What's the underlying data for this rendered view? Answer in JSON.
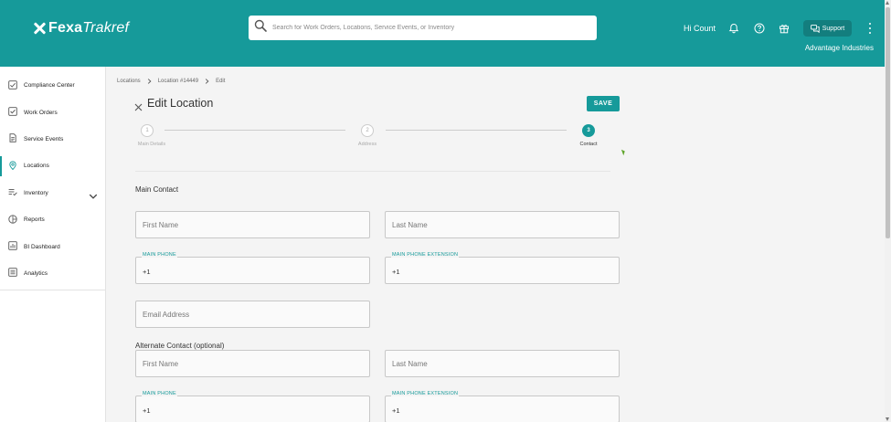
{
  "header": {
    "logo_bold": "Fexa",
    "logo_light": "Trakref",
    "search_placeholder": "Search for Work Orders, Locations, Service Events, or Inventory",
    "greeting": "Hi Count",
    "support_label": "Support",
    "company": "Advantage Industries"
  },
  "sidebar": {
    "items": [
      {
        "label": "Compliance Center",
        "icon": "compliance-icon"
      },
      {
        "label": "Work Orders",
        "icon": "work-orders-icon"
      },
      {
        "label": "Service Events",
        "icon": "document-icon"
      },
      {
        "label": "Locations",
        "icon": "location-pin-icon",
        "active": true
      },
      {
        "label": "Inventory",
        "icon": "inventory-icon",
        "expandable": true
      },
      {
        "label": "Reports",
        "icon": "reports-icon"
      },
      {
        "label": "BI Dashboard",
        "icon": "bar-chart-icon"
      },
      {
        "label": "Analytics",
        "icon": "analytics-icon"
      }
    ]
  },
  "breadcrumb": [
    "Locations",
    "Location #14449",
    "Edit"
  ],
  "page": {
    "title": "Edit Location",
    "save_label": "SAVE"
  },
  "stepper": [
    {
      "number": "1",
      "label": "Main Details",
      "state": "done"
    },
    {
      "number": "2",
      "label": "Address",
      "state": "done"
    },
    {
      "number": "3",
      "label": "Contact",
      "state": "active"
    }
  ],
  "main_contact": {
    "heading": "Main Contact",
    "first_name_placeholder": "First Name",
    "last_name_placeholder": "Last Name",
    "phone_label": "MAIN PHONE",
    "phone_value": "+1",
    "ext_label": "MAIN PHONE EXTENSION",
    "ext_value": "+1",
    "email_placeholder": "Email Address"
  },
  "alternate_contact": {
    "heading": "Alternate Contact (optional)",
    "first_name_placeholder": "First Name",
    "last_name_placeholder": "Last Name",
    "phone_label": "MAIN PHONE",
    "phone_value": "+1",
    "ext_label": "MAIN PHONE EXTENSION",
    "ext_value": "+1"
  },
  "colors": {
    "brand_teal": "#169a9a",
    "support_button": "#137e7e"
  }
}
